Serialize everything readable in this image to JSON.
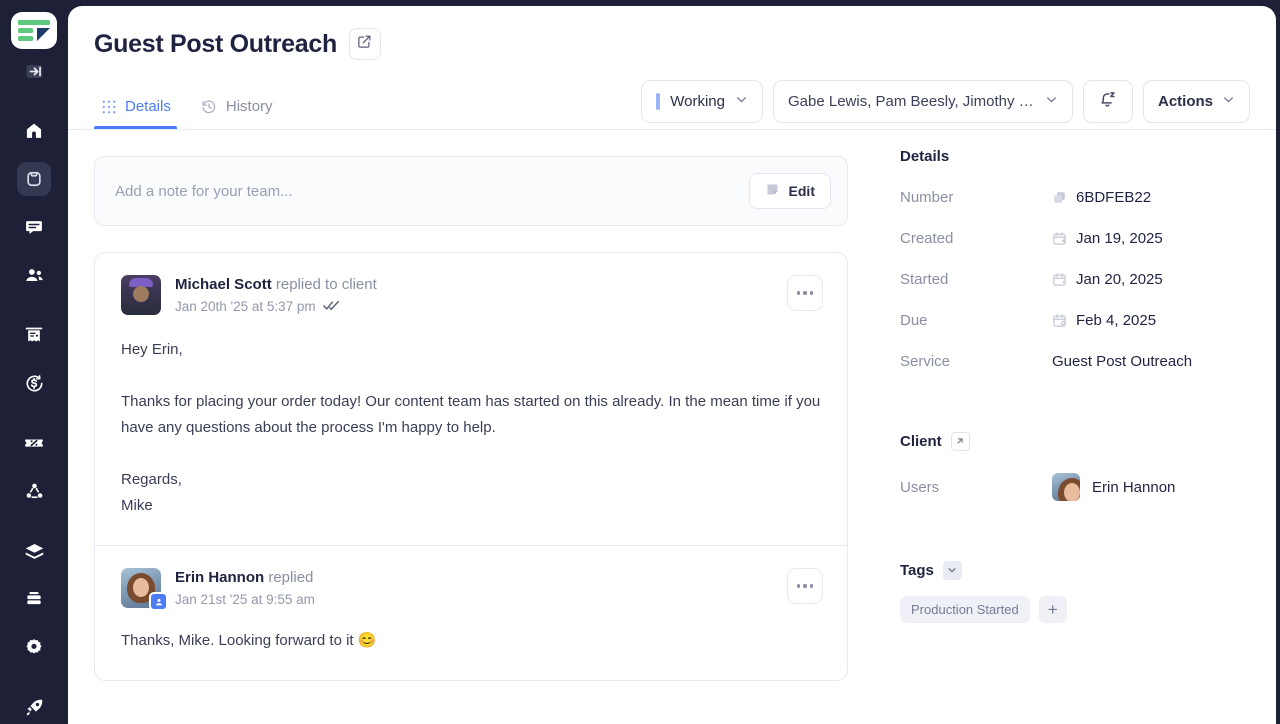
{
  "app": {
    "logo_name": "sendsquare-logo"
  },
  "sidebar": {
    "items": [
      {
        "icon": "collapse-panel-icon",
        "name": "collapse-sidebar"
      },
      {
        "icon": "home-icon",
        "name": "home"
      },
      {
        "icon": "orders-box-icon",
        "name": "orders",
        "active": true
      },
      {
        "icon": "messages-icon",
        "name": "messages"
      },
      {
        "icon": "clients-icon",
        "name": "clients"
      },
      {
        "icon": "invoices-icon",
        "name": "invoices"
      },
      {
        "icon": "refunds-icon",
        "name": "refunds"
      },
      {
        "icon": "coupons-icon",
        "name": "coupons"
      },
      {
        "icon": "integrations-icon",
        "name": "integrations"
      },
      {
        "icon": "layers-icon",
        "name": "services"
      },
      {
        "icon": "database-icon",
        "name": "storage"
      },
      {
        "icon": "settings-gear-icon",
        "name": "settings"
      },
      {
        "icon": "rocket-icon",
        "name": "launch"
      }
    ]
  },
  "header": {
    "title": "Guest Post Outreach",
    "edit_icon": "edit-square-icon"
  },
  "tabs": [
    {
      "label": "Details",
      "icon": "grid-dots-icon",
      "active": true
    },
    {
      "label": "History",
      "icon": "clock-rewind-icon",
      "active": false
    }
  ],
  "toolbar": {
    "status": "Working",
    "status_color": "#9bb4f7",
    "assignees": "Gabe Lewis, Pam Beesly, Jimothy Hal...",
    "snooze_icon": "bell-snooze-icon",
    "actions_label": "Actions"
  },
  "note": {
    "placeholder": "Add a note for your team...",
    "edit_label": "Edit",
    "edit_icon": "note-icon"
  },
  "messages": [
    {
      "author": "Michael Scott",
      "action": "replied to client",
      "timestamp": "Jan 20th '25 at 5:37 pm",
      "read_receipt": "✓✓",
      "avatar": "michael-scott-avatar",
      "is_client": false,
      "body": "Hey Erin,\n\nThanks for placing your order today! Our content team has started on this already. In the mean time if you have any questions about the process I'm happy to help.\n\nRegards,\nMike"
    },
    {
      "author": "Erin Hannon",
      "action": "replied",
      "timestamp": "Jan 21st '25 at 9:55 am",
      "read_receipt": "",
      "avatar": "erin-hannon-avatar",
      "is_client": true,
      "body": "Thanks, Mike. Looking forward to it 😊"
    }
  ],
  "details": {
    "heading": "Details",
    "rows": [
      {
        "label": "Number",
        "value": "6BDFEB22",
        "icon": "copy-icon"
      },
      {
        "label": "Created",
        "value": "Jan 19, 2025",
        "icon": "calendar-plus-icon"
      },
      {
        "label": "Started",
        "value": "Jan 20, 2025",
        "icon": "calendar-play-icon"
      },
      {
        "label": "Due",
        "value": "Feb 4, 2025",
        "icon": "calendar-clock-icon"
      },
      {
        "label": "Service",
        "value": "Guest Post Outreach",
        "icon": ""
      }
    ]
  },
  "client": {
    "heading": "Client",
    "open_icon": "arrow-up-right-icon",
    "users_label": "Users",
    "user_name": "Erin Hannon"
  },
  "tags": {
    "heading": "Tags",
    "toggle_icon": "chevron-down-icon",
    "items": [
      "Production Started"
    ],
    "add_label": "+"
  }
}
